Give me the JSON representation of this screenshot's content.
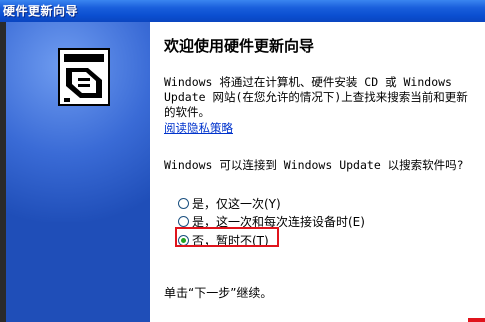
{
  "window": {
    "title": "硬件更新向导"
  },
  "wizard": {
    "heading": "欢迎使用硬件更新向导",
    "description": "Windows 将通过在计算机、硬件安装 CD 或 Windows Update 网站(在您允许的情况下)上查找来搜索当前和更新的软件。",
    "privacy_link": "阅读隐私策略",
    "question": "Windows 可以连接到 Windows Update 以搜索软件吗?",
    "options": [
      {
        "label": "是，仅这一次(Y)",
        "checked": false
      },
      {
        "label": "是，这一次和每次连接设备时(E)",
        "checked": false
      },
      {
        "label": "否，暂时不(T)",
        "checked": true
      }
    ],
    "footer": "单击“下一步”继续。"
  },
  "colors": {
    "title_bar": "#0b4fd1",
    "side_panel": "#1f4eb8",
    "link": "#0033cc",
    "highlight_box": "#e0141c",
    "radio_dot": "#21a121"
  },
  "icons": {
    "wizard_graphic": "hardware-install-icon"
  }
}
